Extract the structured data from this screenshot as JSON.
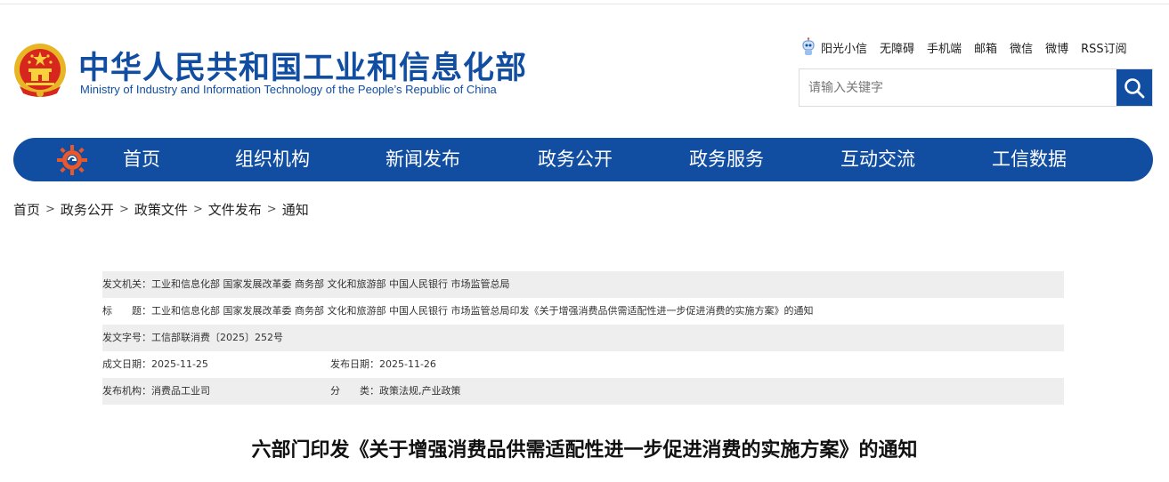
{
  "header": {
    "title_cn": "中华人民共和国工业和信息化部",
    "title_en": "Ministry of Industry and Information Technology of the People’s Republic of China",
    "brand_color": "#114ea2",
    "links": [
      "阳光小信",
      "无障碍",
      "手机端",
      "邮箱",
      "微信",
      "微博",
      "RSS订阅"
    ],
    "search": {
      "placeholder": "请输入关键字",
      "icon": "search-icon"
    }
  },
  "nav": {
    "items": [
      "首页",
      "组织机构",
      "新闻发布",
      "政务公开",
      "政务服务",
      "互动交流",
      "工信数据"
    ]
  },
  "breadcrumb": [
    "首页",
    "政务公开",
    "政策文件",
    "文件发布",
    "通知"
  ],
  "meta": {
    "issuer_label": "发文机关：",
    "issuer_value": "工业和信息化部 国家发展改革委 商务部 文化和旅游部 中国人民银行 市场监管总局",
    "title_label": "标　　题：",
    "title_value": "工业和信息化部 国家发展改革委 商务部 文化和旅游部 中国人民银行 市场监管总局印发《关于增强消费品供需适配性进一步促进消费的实施方案》的通知",
    "docno_label": "发文字号：",
    "docno_value": "工信部联消费〔2025〕252号",
    "created_label": "成文日期：",
    "created_value": "2025-11-25",
    "published_label": "发布日期：",
    "published_value": "2025-11-26",
    "org_label": "发布机构：",
    "org_value": "消费品工业司",
    "category_label": "分　　类：",
    "category_value": "政策法规,产业政策"
  },
  "article": {
    "title": "六部门印发《关于增强消费品供需适配性进一步促进消费的实施方案》的通知"
  }
}
